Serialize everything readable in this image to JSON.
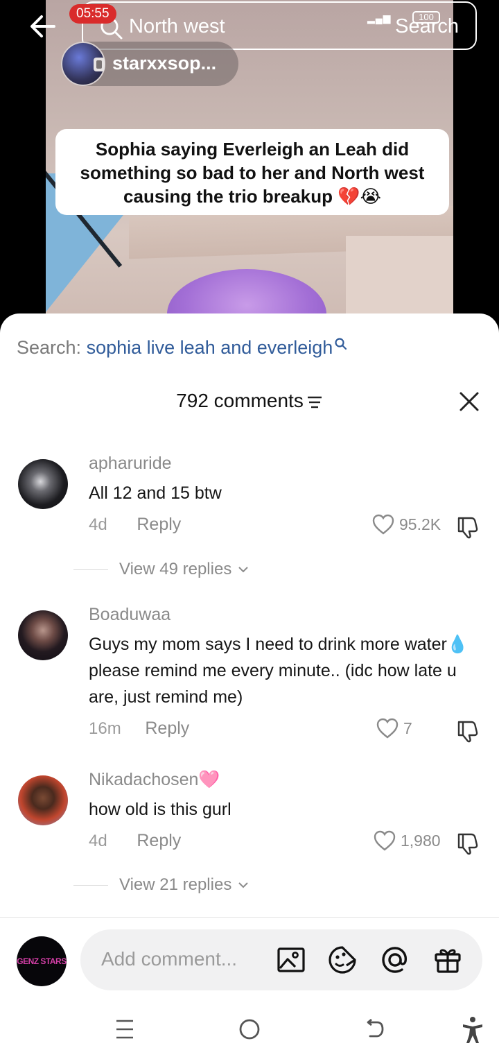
{
  "top_bar": {
    "status_time": "05:55",
    "search_query": "North west",
    "search_button": "Search",
    "battery": "100"
  },
  "video": {
    "creator_name": "starxxsop...",
    "caption": "Sophia saying Everleigh an Leah did something so bad to her and North west causing the trio breakup 💔😭"
  },
  "sheet": {
    "search_label": "Search:",
    "search_term": "sophia live leah and everleigh",
    "comment_count": "792 comments"
  },
  "comments": [
    {
      "username": "apharuride",
      "text": "All 12 and 15 btw",
      "time": "4d",
      "reply_label": "Reply",
      "likes": "95.2K",
      "view_replies": "View 49 replies"
    },
    {
      "username": "Boaduwaa",
      "text": "Guys my mom says I need to drink more water💧 please remind me every minute.. (idc how late u are, just remind me)",
      "time": "16m",
      "reply_label": "Reply",
      "likes": "7"
    },
    {
      "username": "Nikadachosen🩷",
      "text": "how old is this gurl",
      "time": "4d",
      "reply_label": "Reply",
      "likes": "1,980",
      "view_replies": "View 21 replies"
    }
  ],
  "composer": {
    "placeholder": "Add comment...",
    "avatar_text": "GENZ STARS"
  },
  "colors": {
    "link_blue": "#315c9a",
    "status_red": "#d92b2b",
    "sheet_bg": "#ffffff",
    "muted_text": "#8a8a8a"
  },
  "icons": [
    "back-arrow-icon",
    "search-icon",
    "close-icon",
    "sort-icon",
    "heart-icon",
    "dislike-icon",
    "chevron-down-icon",
    "image-icon",
    "emoji-icon",
    "mention-icon",
    "gift-icon",
    "recents-icon",
    "home-icon",
    "back-icon",
    "accessibility-icon"
  ]
}
